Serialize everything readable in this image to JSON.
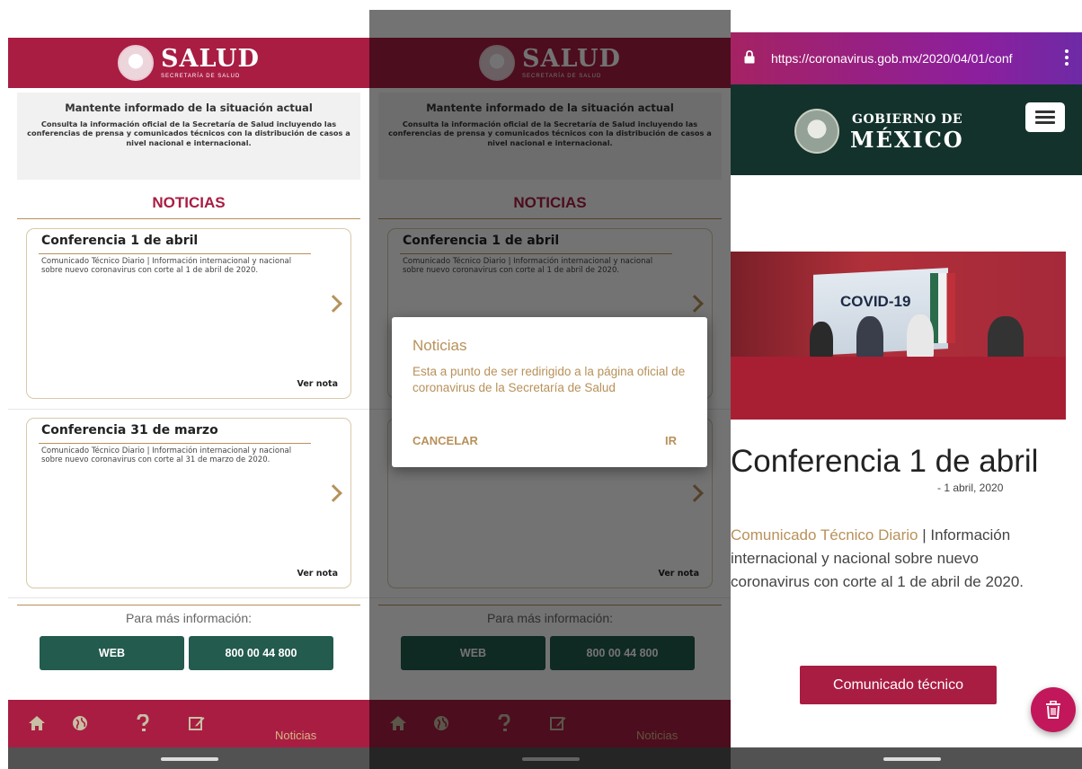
{
  "app": {
    "brand_title": "SALUD",
    "brand_subtitle": "SECRETARÍA DE SALUD",
    "info_title": "Mantente informado de la situación actual",
    "info_text": "Consulta la información oficial de la Secretaría de Salud incluyendo las conferencias de prensa y comunicados técnicos con la distribución de casos a nivel nacional e internacional.",
    "section_title": "NOTICIAS",
    "cards": [
      {
        "title": "Conferencia 1 de abril",
        "text": "Comunicado Técnico Diario | Información internacional y nacional sobre nuevo coronavirus con corte al 1 de abril de 2020.",
        "link": "Ver nota"
      },
      {
        "title": "Conferencia 31 de marzo",
        "text": "Comunicado Técnico Diario | Información internacional y nacional sobre nuevo coronavirus con corte al 31 de marzo de 2020.",
        "link": "Ver nota"
      }
    ],
    "more_info_label": "Para más información:",
    "web_button": "WEB",
    "phone_button": "800 00 44 800",
    "nav": {
      "icons": [
        "home-icon",
        "globe-icon",
        "question-icon",
        "edit-icon"
      ],
      "active_label": "Noticias"
    }
  },
  "dialog": {
    "title": "Noticias",
    "message": "Esta a punto de ser redirigido a la página oficial de coronavirus de la Secretaría de Salud",
    "cancel_label": "CANCELAR",
    "ok_label": "IR"
  },
  "browser": {
    "url": "https://coronavirus.gob.mx/2020/04/01/conf",
    "gov_line1": "GOBIERNO DE",
    "gov_line2": "MÉXICO",
    "photo_caption": "COVID-19",
    "article_title": "Conferencia 1 de abril",
    "article_date": "- 1 abril, 2020",
    "article_link": "Comunicado Técnico Diario",
    "article_separator": " | ",
    "article_body": "Información internacional y nacional sobre nuevo coronavirus con corte al 1 de abril de 2020.",
    "button_label": "Comunicado técnico",
    "fab_icon": "trash-icon"
  },
  "colors": {
    "brand_red": "#a91d43",
    "gold": "#b8915a",
    "green": "#235b4e",
    "gov_dark_green": "#13322b"
  }
}
